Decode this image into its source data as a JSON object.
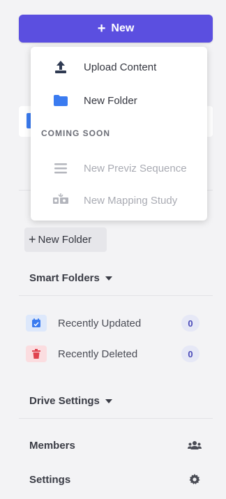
{
  "new_button": {
    "label": "New"
  },
  "dropdown": {
    "items": [
      {
        "label": "Upload Content",
        "icon": "upload-icon"
      },
      {
        "label": "New Folder",
        "icon": "folder-icon"
      }
    ],
    "section_label": "COMING SOON",
    "disabled_items": [
      {
        "label": "New Previz Sequence",
        "icon": "sequence-icon"
      },
      {
        "label": "New Mapping Study",
        "icon": "mapping-study-icon"
      }
    ]
  },
  "new_folder_button": {
    "label": "New Folder"
  },
  "smart_folders": {
    "header": "Smart Folders",
    "items": [
      {
        "label": "Recently Updated",
        "count": "0",
        "icon": "calendar-icon",
        "color": "#3a7bf0",
        "bg": "#dde8fb"
      },
      {
        "label": "Recently Deleted",
        "count": "0",
        "icon": "trash-icon",
        "color": "#e0434f",
        "bg": "#fbdde0"
      }
    ]
  },
  "drive_settings": {
    "header": "Drive Settings",
    "items": [
      {
        "label": "Members",
        "icon": "members-icon"
      },
      {
        "label": "Settings",
        "icon": "gear-icon"
      }
    ]
  },
  "colors": {
    "accent": "#5b4fe0",
    "folder_blue": "#3a7bf0"
  }
}
